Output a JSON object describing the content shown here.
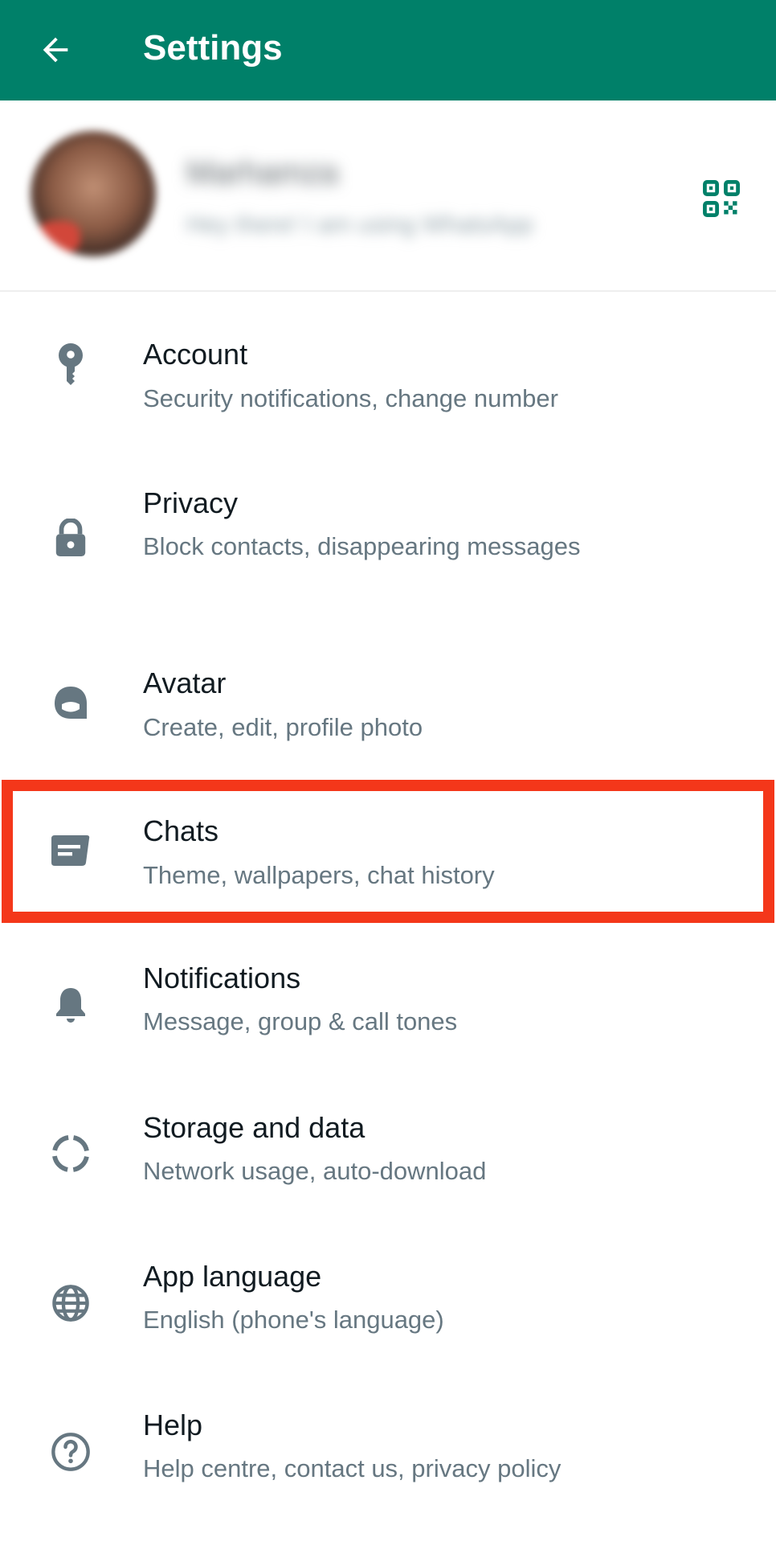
{
  "header": {
    "title": "Settings",
    "back_icon": "back-arrow-icon",
    "background_color": "#008069"
  },
  "profile": {
    "name": "Marhamza",
    "about": "Hey there! I am using WhatsApp",
    "qr_icon": "qr-code-icon",
    "accent_color": "#008069"
  },
  "settings": {
    "items": [
      {
        "id": "account",
        "icon": "key-icon",
        "title": "Account",
        "subtitle": "Security notifications, change number"
      },
      {
        "id": "privacy",
        "icon": "lock-icon",
        "title": "Privacy",
        "subtitle": "Block contacts, disappearing messages"
      },
      {
        "id": "avatar",
        "icon": "avatar-face-icon",
        "title": "Avatar",
        "subtitle": "Create, edit, profile photo"
      },
      {
        "id": "chats",
        "icon": "chat-bubble-icon",
        "title": "Chats",
        "subtitle": "Theme, wallpapers, chat history",
        "highlighted": true
      },
      {
        "id": "notifications",
        "icon": "bell-icon",
        "title": "Notifications",
        "subtitle": "Message, group & call tones"
      },
      {
        "id": "storage",
        "icon": "storage-circle-icon",
        "title": "Storage and data",
        "subtitle": "Network usage, auto-download"
      },
      {
        "id": "language",
        "icon": "globe-icon",
        "title": "App language",
        "subtitle": "English (phone's language)"
      },
      {
        "id": "help",
        "icon": "help-circle-icon",
        "title": "Help",
        "subtitle": "Help centre, contact us, privacy policy"
      }
    ]
  },
  "colors": {
    "icon_gray": "#667781",
    "title_text": "#111b21",
    "subtitle_text": "#667781",
    "highlight_border": "#f4371a"
  }
}
